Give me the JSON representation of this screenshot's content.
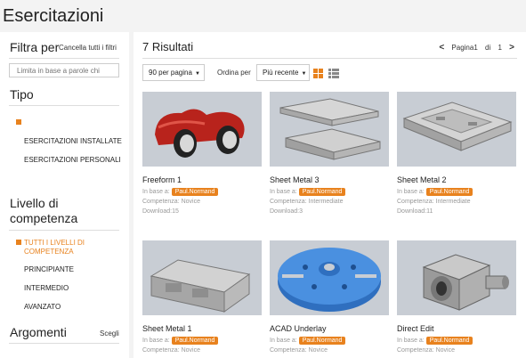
{
  "page": {
    "title": "Esercitazioni"
  },
  "sidebar": {
    "filter_heading": "Filtra per",
    "clear_all": "Cancella tutti i filtri",
    "search_placeholder": "Limita in base a parole chi",
    "tipo": {
      "heading": "Tipo",
      "items": [
        "ESERCITAZIONI INSTALLATE",
        "ESERCITAZIONI PERSONALI"
      ]
    },
    "livello": {
      "heading": "Livello di competenza",
      "items": [
        {
          "label": "TUTTI I LIVELLI DI COMPETENZA",
          "active": true
        },
        {
          "label": "PRINCIPIANTE",
          "active": false
        },
        {
          "label": "INTERMEDIO",
          "active": false
        },
        {
          "label": "AVANZATO",
          "active": false
        }
      ]
    },
    "argomenti": {
      "heading": "Argomenti",
      "action": "Scegli"
    }
  },
  "main": {
    "results_label": "7 Risultati",
    "pager": {
      "prev": "<",
      "page_label": "Pagina1",
      "of": "di",
      "total": "1",
      "next": ">"
    },
    "per_page": "90 per pagina",
    "sort_label": "Ordina per",
    "sort_value": "Più recente",
    "cards": [
      {
        "title": "Freeform 1",
        "based_on": "In base a:",
        "author": "Paul.Normand",
        "level": "Competenza: Novice",
        "downloads": "Download:15",
        "thumb": "freeform"
      },
      {
        "title": "Sheet Metal 3",
        "based_on": "In base a:",
        "author": "Paul.Normand",
        "level": "Competenza: Intermediate",
        "downloads": "Download:3",
        "thumb": "sheetmetal3"
      },
      {
        "title": "Sheet Metal 2",
        "based_on": "In base a:",
        "author": "Paul.Normand",
        "level": "Competenza: Intermediate",
        "downloads": "Download:11",
        "thumb": "sheetmetal2"
      },
      {
        "title": "Sheet Metal 1",
        "based_on": "In base a:",
        "author": "Paul.Normand",
        "level": "Competenza: Novice",
        "downloads": "",
        "thumb": "sheetmetal1"
      },
      {
        "title": "ACAD Underlay",
        "based_on": "In base a:",
        "author": "Paul.Normand",
        "level": "Competenza: Novice",
        "downloads": "",
        "thumb": "acad"
      },
      {
        "title": "Direct Edit",
        "based_on": "In base a:",
        "author": "Paul.Normand",
        "level": "Competenza: Novice",
        "downloads": "",
        "thumb": "directedit"
      }
    ]
  },
  "colors": {
    "accent": "#e8821e",
    "thumb_bg": "#c8cdd4"
  }
}
